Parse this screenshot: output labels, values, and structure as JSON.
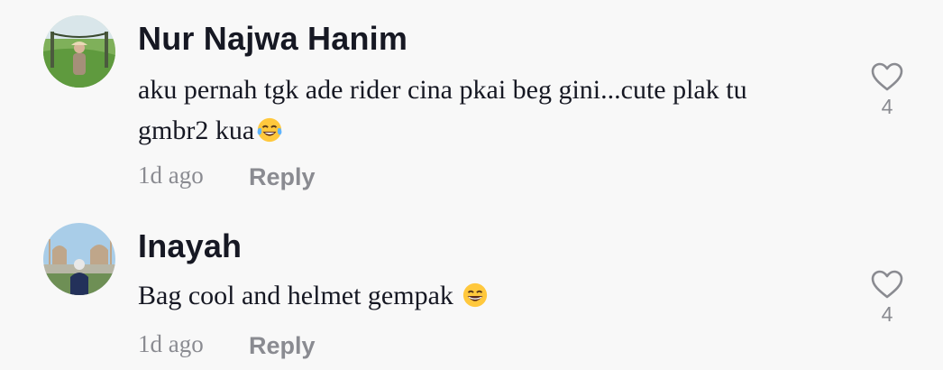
{
  "comments": [
    {
      "author": "Nur Najwa Hanim",
      "text": "aku pernah tgk ade rider cina pkai beg gini...cute plak tu gmbr2 kua",
      "emoji": "face-with-tears-of-joy",
      "time": "1d ago",
      "reply_label": "Reply",
      "likes": "4",
      "avatar_icon": "avatar-rice-field-person"
    },
    {
      "author": "Inayah",
      "text": "Bag cool and helmet gempak ",
      "emoji": "grinning-face",
      "time": "1d ago",
      "reply_label": "Reply",
      "likes": "4",
      "avatar_icon": "avatar-mosque-person"
    }
  ],
  "colors": {
    "background": "#f8f8f8",
    "primary_text": "#161823",
    "secondary_text": "#8a8b91",
    "emoji_yellow": "#ffc83d"
  }
}
